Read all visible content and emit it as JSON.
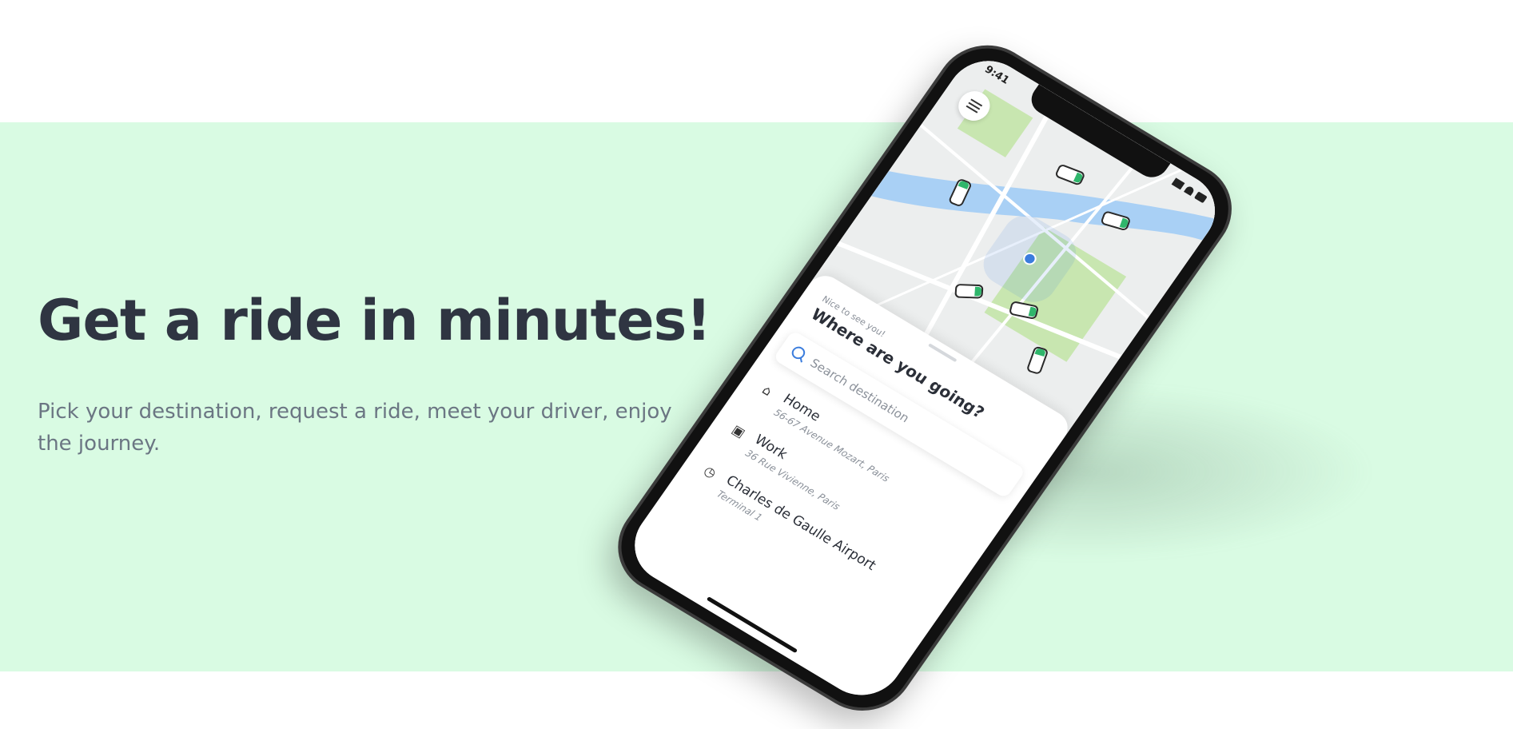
{
  "hero": {
    "headline": "Get a ride in minutes!",
    "subtext": "Pick your destination, request a ride, meet your driver, enjoy the journey."
  },
  "colors": {
    "background_mint": "#d9fbe3",
    "headline": "#2f3542",
    "subtext": "#6b7683",
    "accent_blue": "#3b7ddd",
    "car_green": "#2fb66b"
  },
  "phone": {
    "status_time": "9:41",
    "menu_icon": "hamburger-menu-icon",
    "sheet": {
      "greeting": "Nice to see you!",
      "question": "Where are you going?",
      "search_placeholder": "Search destination",
      "places": [
        {
          "icon": "home-icon",
          "name": "Home",
          "address": "56-67 Avenue Mozart, Paris"
        },
        {
          "icon": "briefcase-icon",
          "name": "Work",
          "address": "36 Rue Vivienne, Paris"
        },
        {
          "icon": "clock-icon",
          "name": "Charles de Gaulle Airport",
          "address": "Terminal 1"
        }
      ]
    }
  }
}
